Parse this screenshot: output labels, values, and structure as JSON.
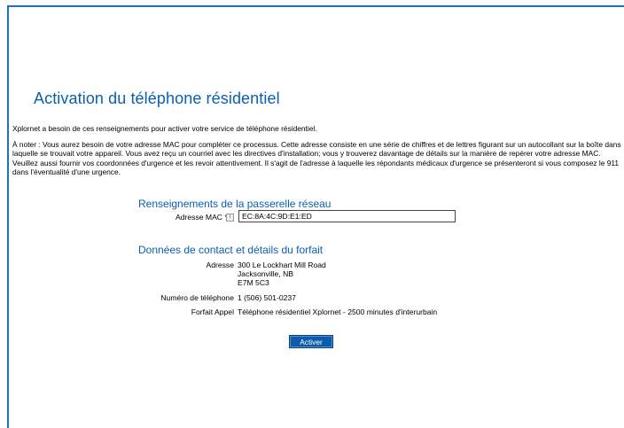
{
  "title": "Activation du téléphone résidentiel",
  "intro": "Xplornet a besoin de ces renseignements pour activer votre service de téléphone résidentiel.",
  "note": "À noter : Vous aurez besoin de votre adresse MAC pour compléter ce processus. Cette adresse consiste en une série de chiffres et de lettres figurant sur un autocollant sur la boîte dans laquelle se trouvait votre appareil. Vous avez reçu un courriel avec les directives d'installation; vous y trouverez davantage de détails sur la manière de repérer votre adresse MAC. Veuillez aussi fournir vos coordonnées d'urgence et les revoir attentivement. Il s'agit de l'adresse à laquelle les répondants médicaux d'urgence se présenteront si vous composez le 911 dans l'éventualité d'une urgence.",
  "gateway": {
    "heading": "Renseignements de la passerelle réseau",
    "mac_label": "Adresse MAC *",
    "mac_value": "EC:8A:4C:9D:E1:ED"
  },
  "contact": {
    "heading": "Données de contact et détails du forfait",
    "address_label": "Adresse",
    "address_line1": "300 Le Lockhart Mill Road",
    "address_line2": "Jacksonville, NB",
    "address_line3": "E7M 5C3",
    "phone_label": "Numéro de téléphone",
    "phone_value": "1 (506) 501-0237",
    "plan_label": "Forfait Appel",
    "plan_value": "Téléphone résidentiel Xplornet - 2500 minutes d'interurbain"
  },
  "activate_label": "Activer",
  "accent_color": "#0b5fb0"
}
